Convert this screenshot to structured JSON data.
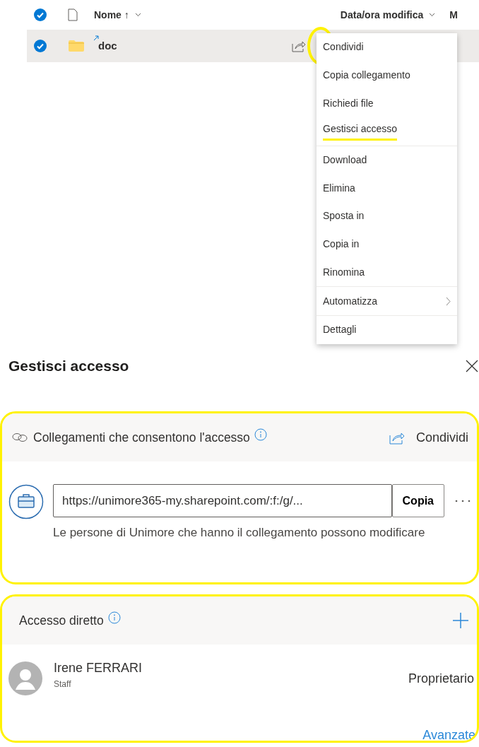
{
  "file_list": {
    "header": {
      "checked": true,
      "name_column": "Nome ↑",
      "modified_column": "Data/ora modifica",
      "column_3": "M"
    },
    "rows": [
      {
        "name": "doc",
        "checked": true,
        "selected": true,
        "more_highlighted": true
      }
    ]
  },
  "context_menu": {
    "groups": [
      [
        {
          "label": "Condividi",
          "highlighted": false,
          "submenu": false
        },
        {
          "label": "Copia collegamento",
          "highlighted": false,
          "submenu": false
        },
        {
          "label": "Richiedi file",
          "highlighted": false,
          "submenu": false
        },
        {
          "label": "Gestisci accesso",
          "highlighted": true,
          "submenu": false
        }
      ],
      [
        {
          "label": "Download",
          "highlighted": false,
          "submenu": false
        },
        {
          "label": "Elimina",
          "highlighted": false,
          "submenu": false
        },
        {
          "label": "Sposta in",
          "highlighted": false,
          "submenu": false
        },
        {
          "label": "Copia in",
          "highlighted": false,
          "submenu": false
        },
        {
          "label": "Rinomina",
          "highlighted": false,
          "submenu": false
        }
      ],
      [
        {
          "label": "Automatizza",
          "highlighted": false,
          "submenu": true
        }
      ],
      [
        {
          "label": "Dettagli",
          "highlighted": false,
          "submenu": false
        }
      ]
    ]
  },
  "panel": {
    "title": "Gestisci accesso",
    "links_section": {
      "highlighted": true,
      "title": "Collegamenti che consentono l'accesso",
      "share_button": "Condividi",
      "link_url": "https://unimore365-my.sharepoint.com/:f:/g/...",
      "copy_button": "Copia",
      "description": "Le persone di Unimore che hanno il collegamento possono modificare"
    },
    "direct_access_section": {
      "highlighted": true,
      "title": "Accesso diretto",
      "members": [
        {
          "name": "Irene FERRARI",
          "subtitle": "Staff",
          "permission": "Proprietario"
        }
      ],
      "advanced_link": "Avanzate"
    }
  }
}
